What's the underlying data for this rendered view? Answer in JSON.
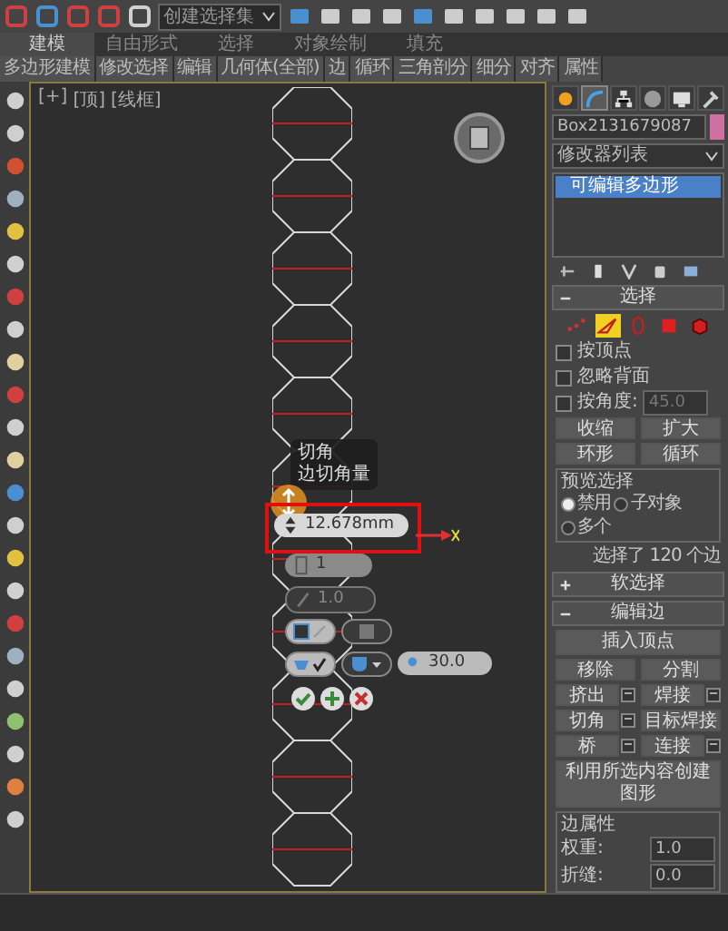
{
  "toolbar": {
    "selection_set": "创建选择集"
  },
  "ribbon": {
    "tabs": [
      {
        "label": "建模",
        "selected": true
      },
      {
        "label": "自由形式",
        "selected": false
      },
      {
        "label": "选择",
        "selected": false
      },
      {
        "label": "对象绘制",
        "selected": false
      },
      {
        "label": "填充",
        "selected": false
      }
    ],
    "panels": [
      "多边形建模",
      "修改选择",
      "编辑",
      "几何体(全部)",
      "边",
      "循环",
      "三角剖分",
      "细分",
      "对齐",
      "属性"
    ]
  },
  "viewport": {
    "labels": [
      "[+]",
      "[顶]",
      "[线框]"
    ],
    "caddy": {
      "tooltip": [
        "切角",
        "边切角量"
      ],
      "amount": "12.678mm",
      "segments": "1",
      "tension": "1.0",
      "tension_disabled": true,
      "angle": "30.0"
    }
  },
  "command_panel": {
    "tabs": [
      {
        "kind": "create",
        "selected": false
      },
      {
        "kind": "modify",
        "selected": true
      },
      {
        "kind": "hierarchy",
        "selected": false
      },
      {
        "kind": "motion",
        "selected": false
      },
      {
        "kind": "display",
        "selected": false
      },
      {
        "kind": "utilities",
        "selected": false
      }
    ],
    "object_name": "Box2131679087",
    "modifier_list": "修改器列表",
    "stack": [
      {
        "label": "可编辑多边形",
        "selected": true
      }
    ],
    "selection": {
      "title": "选择",
      "expanded": true,
      "subobjects": [
        {
          "kind": "vertex",
          "selected": false
        },
        {
          "kind": "edge",
          "selected": true
        },
        {
          "kind": "border",
          "selected": false
        },
        {
          "kind": "polygon",
          "selected": false
        },
        {
          "kind": "element",
          "selected": false
        }
      ],
      "checkboxes": [
        {
          "label": "按顶点",
          "checked": false
        },
        {
          "label": "忽略背面",
          "checked": false
        },
        {
          "label": "按角度:",
          "checked": false,
          "value": "45.0"
        }
      ],
      "buttons": [
        "收缩",
        "扩大"
      ],
      "spinner_buttons": [
        "环形",
        "循环"
      ],
      "preview": {
        "title": "预览选择",
        "options": [
          {
            "label": "禁用",
            "selected": true
          },
          {
            "label": "子对象",
            "selected": false
          },
          {
            "label": "多个",
            "selected": false
          }
        ]
      },
      "status": "选择了 120 个边"
    },
    "soft_selection": {
      "title": "软选择",
      "expanded": false
    },
    "edit_edges": {
      "title": "编辑边",
      "expanded": true,
      "insert": "插入顶点",
      "rows": [
        [
          {
            "label": "移除",
            "settings": false
          },
          {
            "label": "分割",
            "settings": false
          }
        ],
        [
          {
            "label": "挤出",
            "settings": true
          },
          {
            "label": "焊接",
            "settings": true
          }
        ],
        [
          {
            "label": "切角",
            "settings": true
          },
          {
            "label": "目标焊接",
            "settings": false
          }
        ],
        [
          {
            "label": "桥",
            "settings": true
          },
          {
            "label": "连接",
            "settings": true
          }
        ]
      ],
      "create_shape": "利用所选内容创建图形",
      "properties": {
        "title": "边属性",
        "fields": [
          {
            "label": "权重:",
            "value": "1.0"
          },
          {
            "label": "折缝:",
            "value": "0.0"
          }
        ]
      }
    }
  }
}
